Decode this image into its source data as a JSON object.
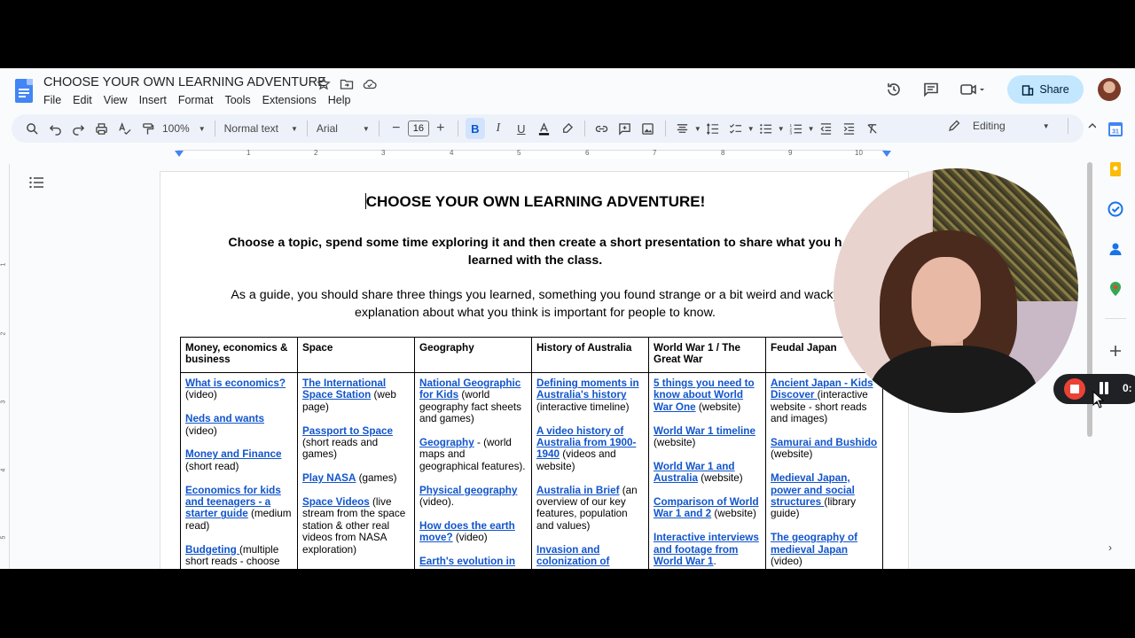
{
  "app": {
    "doc_title": "CHOOSE YOUR OWN LEARNING ADVENTURE",
    "menu": [
      "File",
      "Edit",
      "View",
      "Insert",
      "Format",
      "Tools",
      "Extensions",
      "Help"
    ],
    "share_label": "Share"
  },
  "toolbar": {
    "zoom": "100%",
    "style": "Normal text",
    "font": "Arial",
    "font_size": "16",
    "mode": "Editing"
  },
  "ruler": {
    "numbers": [
      "1",
      "2",
      "3",
      "4",
      "5",
      "6",
      "7",
      "8",
      "9",
      "10"
    ]
  },
  "vruler": {
    "numbers": [
      "1",
      "2",
      "3",
      "4",
      "5"
    ]
  },
  "document": {
    "heading": "CHOOSE YOUR OWN LEARNING ADVENTURE!",
    "intro_bold": "Choose a topic, spend some time exploring it and then create a short presentation to share what you have learned with the class.",
    "intro_bold_line1": "Choose a topic, spend some time exploring it and then create a short presentation to share what you h",
    "intro_bold_line2": "learned with the class.",
    "intro_line1": "As a guide, you should share three things you learned, something you found strange or a bit weird and wacky",
    "intro_line2": "explanation about what you think is important for people to know.",
    "table": {
      "headers": [
        "Money, economics & business",
        "Space",
        "Geography",
        "History of Australia",
        "World War 1 / The Great War",
        "Feudal Japan"
      ],
      "columns": [
        [
          {
            "link": "What is economics?",
            "text": " (video)"
          },
          {
            "link": "Neds and wants",
            "text": " (video)"
          },
          {
            "link": "Money and Finance",
            "text": " (short read)"
          },
          {
            "link": "Economics for kids and teenagers - a starter guide",
            "text": " (medium read)"
          },
          {
            "link": "Budgeting ",
            "text": "(multiple short reads - choose"
          }
        ],
        [
          {
            "link": "The International Space Station",
            "text": " (web page)"
          },
          {
            "link": "Passport to Space",
            "text": " (short reads and games)"
          },
          {
            "link": "Play NASA",
            "text": " (games)"
          },
          {
            "link": "Space Videos",
            "text": " (live stream from the space station & other real videos from NASA exploration)"
          }
        ],
        [
          {
            "link": "National Geographic for Kids",
            "text": " (world geography fact sheets and games)"
          },
          {
            "link": "Geography",
            "text": " - (world maps and geographical features)."
          },
          {
            "link": "Physical geography",
            "text": " (video)."
          },
          {
            "link": "How does the earth move?",
            "text": " (video)"
          },
          {
            "link": "Earth's evolution in",
            "text": ""
          }
        ],
        [
          {
            "link": "Defining moments in Australia's history",
            "text": " (interactive timeline)"
          },
          {
            "link": "A video history of Australia from 1900-1940",
            "text": " (videos and website)"
          },
          {
            "link": "Australia in Brief",
            "text": " (an overview of our key features, population and values)"
          },
          {
            "link": "Invasion and colonization of",
            "text": ""
          }
        ],
        [
          {
            "link": "5 things you need to know about World War One",
            "text": " (website)"
          },
          {
            "link": "World War 1 timeline",
            "text": " (website)"
          },
          {
            "link": "World War 1 and Australia",
            "text": " (website)"
          },
          {
            "link": "Comparison of World War 1 and 2",
            "text": " (website)"
          },
          {
            "link": "Interactive interviews and footage from World War 1",
            "text": "."
          }
        ],
        [
          {
            "link": "Ancient Japan - Kids Discover ",
            "text": " (interactive website - short reads and images)"
          },
          {
            "link": "Samurai and Bushido",
            "text": " (website)"
          },
          {
            "link": "Medieval Japan, power and social structures ",
            "text": "(library guide)"
          },
          {
            "link": "The geography of medieval Japan",
            "text": " (video)"
          }
        ]
      ]
    }
  },
  "recorder": {
    "time": "0:"
  },
  "colors": {
    "link": "#1155cc",
    "share_bg": "#c2e7ff",
    "toolbar_bg": "#edf2fa",
    "record_red": "#ea4335"
  }
}
